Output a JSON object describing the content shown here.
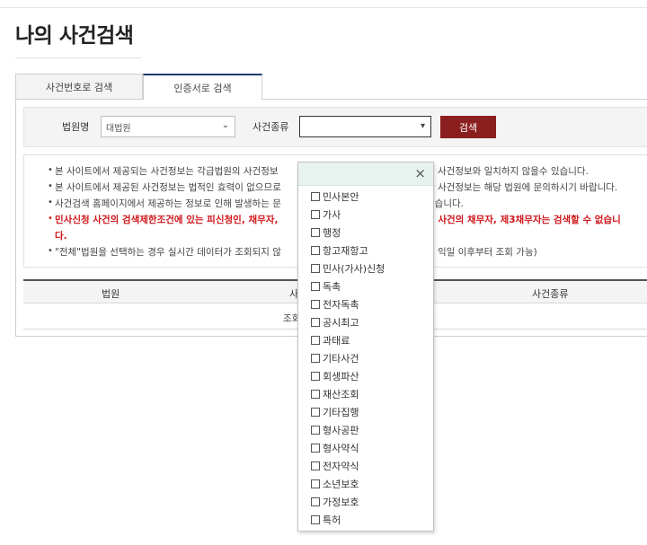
{
  "page": {
    "title": "나의 사건검색"
  },
  "tabs": [
    {
      "label": "사건번호로 검색"
    },
    {
      "label": "인증서로 검색"
    }
  ],
  "search": {
    "court_label": "법원명",
    "court_value": "대법원",
    "case_type_label": "사건종류",
    "case_type_value": "",
    "search_button": "검색"
  },
  "notices": [
    {
      "text": "본 사이트에서 제공되는 사건정보는 각급법원의 사건정보",
      "right": "에 사건정보와 일치하지 않을수 있습니다.",
      "red": false
    },
    {
      "text": "본 사이트에서 제공된 사건정보는 법적인 효력이 없으므로",
      "right": "한 사건정보는 해당 법원에 문의하시기 바랍니다.",
      "red": false
    },
    {
      "text": "사건검색 홈페이지에서 제공하는 정보로 인해 발생하는 문",
      "right": "않습니다.",
      "red": false
    },
    {
      "text": "민사신청 사건의 검색제한조건에 있는 피신청인, 채무자,",
      "right": "행 사건의 채무자, 제3채무자는 검색할 수 없습니",
      "red": true
    },
    {
      "text": "다.",
      "right": "",
      "red": true
    },
    {
      "text": "\"전체\"법원을 선택하는 경우 실시간 데이터가 조회되지 않",
      "right": "은 익일 이후부터 조회 가능)",
      "red": false
    }
  ],
  "table": {
    "headers": [
      "법원",
      "사",
      "사건종류"
    ],
    "empty_text": "조회"
  },
  "dropdown": {
    "close_icon": "×",
    "options": [
      "민사본안",
      "가사",
      "행정",
      "항고재항고",
      "민사(가사)신청",
      "독촉",
      "전자독촉",
      "공시최고",
      "과태료",
      "기타사건",
      "회생파산",
      "재산조회",
      "기타집행",
      "형사공판",
      "형사약식",
      "전자약식",
      "소년보호",
      "가정보호",
      "특허"
    ]
  },
  "colors": {
    "accent": "#8b1f1f",
    "tab_active": "#1f3a6e",
    "warning": "#d0161b"
  }
}
